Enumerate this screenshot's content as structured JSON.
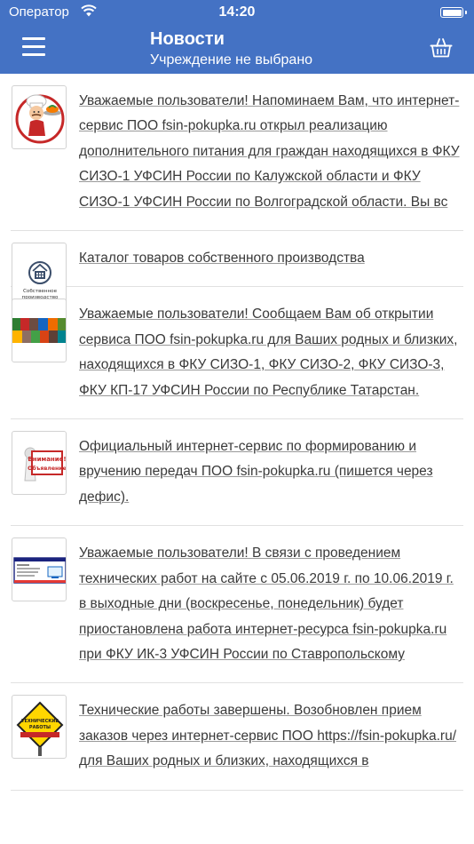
{
  "status_bar": {
    "carrier": "Оператор",
    "time": "14:20"
  },
  "nav": {
    "title": "Новости",
    "subtitle": "Учреждение не выбрано",
    "menu_icon": "hamburger-menu-icon",
    "basket_icon": "basket-icon"
  },
  "news": [
    {
      "thumb": "chef-mascot-image",
      "text": "Уважаемые пользователи! Напоминаем Вам, что интернет-сервис ПОО fsin-pokupka.ru открыл реализацию дополнительного питания для граждан находящихся в ФКУ СИЗО-1 УФСИН России по Калужской области и ФКУ СИЗО-1 УФСИН России по Волгоградской области. Вы вс"
    },
    {
      "thumb": "own-production-logo",
      "thumb_caption": "Собственное производство",
      "text": "Каталог товаров собственного производства"
    },
    {
      "thumb": "photo-collage-image",
      "text": "Уважаемые пользователи! Сообщаем Вам об открытии сервиса ПОО fsin-pokupka.ru для Ваших родных и близких, находящихся в ФКУ СИЗО-1, ФКУ СИЗО-2, ФКУ СИЗО-3, ФКУ КП-17 УФСИН России по Республике Татарстан."
    },
    {
      "thumb": "attention-sign-image",
      "thumb_caption": "Внимание! Объявление",
      "text": "Официальный интернет-сервис по формированию и вручению передач ПОО fsin-pokupka.ru (пишется через дефис)."
    },
    {
      "thumb": "maintenance-notice-image",
      "text": "Уважаемые пользователи! В связи с проведением технических работ на сайте с 05.06.2019 г. по 10.06.2019 г. в выходные дни (воскресенье, понедельник) будет приостановлена работа интернет-ресурса fsin-pokupka.ru при ФКУ ИК-3 УФСИН России по Ставропольскому"
    },
    {
      "thumb": "technical-works-sign-image",
      "thumb_caption": "ТЕХНИЧЕСКИЕ РАБОТЫ",
      "text": "Технические работы завершены. Возобновлен прием заказов через интернет-сервис ПОО https://fsin-pokupka.ru/ для Ваших родных и близких, находящихся в"
    }
  ],
  "colors": {
    "header": "#4472c4",
    "link_text": "#3a3a3a"
  }
}
